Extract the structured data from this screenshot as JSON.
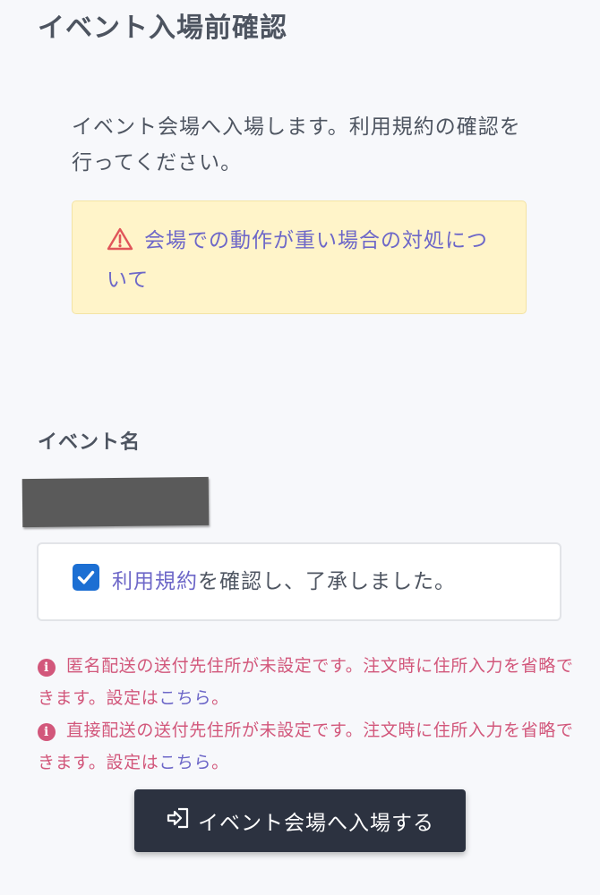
{
  "page": {
    "title": "イベント入場前確認"
  },
  "intro": {
    "text": "イベント会場へ入場します。利用規約の確認を行ってください。"
  },
  "notice": {
    "icon": "warning-triangle-icon",
    "link_text": "会場での動作が重い場合の対処について"
  },
  "event": {
    "label": "イベント名"
  },
  "terms": {
    "checked": true,
    "link_text": "利用規約",
    "suffix": "を確認し、了承しました。"
  },
  "alerts": [
    {
      "icon": "info-icon",
      "text": "匿名配送の送付先住所が未設定です。注文時に住所入力を省略できます。設定は",
      "link_text": "こちら",
      "end": "。"
    },
    {
      "icon": "info-icon",
      "text": "直接配送の送付先住所が未設定です。注文時に住所入力を省略できます。設定は",
      "link_text": "こちら",
      "end": "。"
    }
  ],
  "enter_button": {
    "icon": "enter-icon",
    "label": "イベント会場へ入場する"
  },
  "colors": {
    "link": "#6d67c8",
    "alert": "#d2577b",
    "notice_bg": "#fff4c9",
    "button_bg": "#2c3240",
    "checkbox": "#1c6fd3"
  }
}
